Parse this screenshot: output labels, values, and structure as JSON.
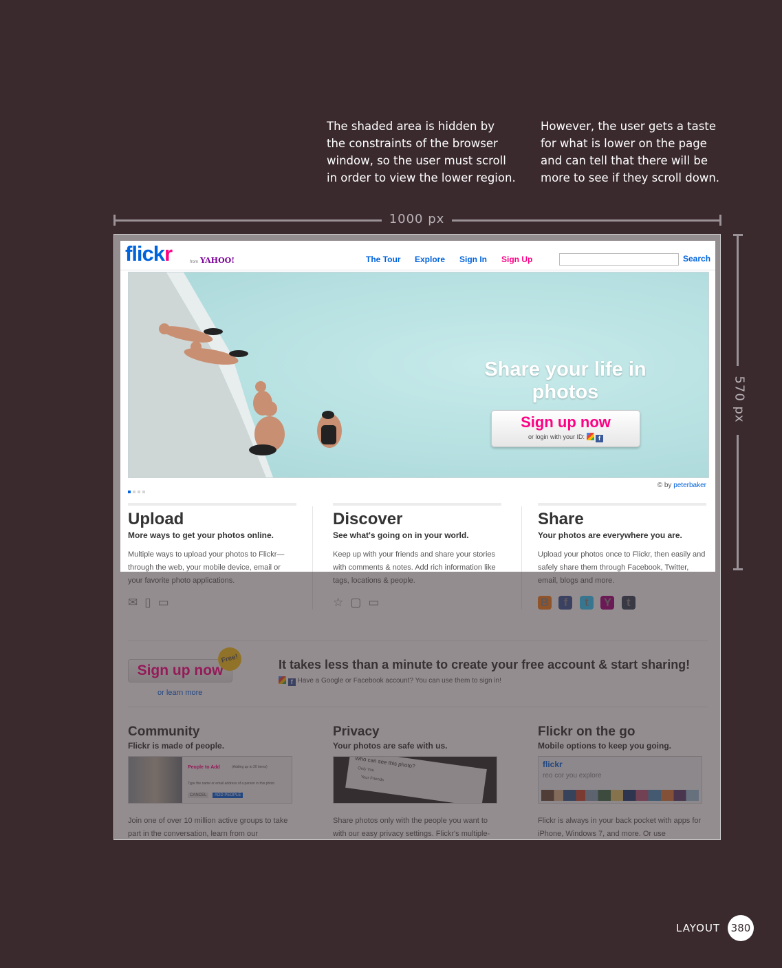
{
  "annotations": {
    "left": "The shaded area is hidden by\nthe constraints of the browser\nwindow, so the user must scroll\nin order to view the lower region.",
    "right": "However, the user gets a taste\nfor what is lower on the page\nand can tell that there will be\nmore to see if they scroll down."
  },
  "dimensions": {
    "width_label": "1000 px",
    "height_label": "570 px"
  },
  "site": {
    "logo_text_main": "flick",
    "logo_text_accent": "r",
    "logo_by": "from",
    "logo_yahoo": "YAHOO!",
    "nav": [
      "The Tour",
      "Explore",
      "Sign In",
      "Sign Up"
    ],
    "search_button": "Search",
    "hero": {
      "title": "Share your life in photos",
      "cta": "Sign up now",
      "cta_sub": "or login with your ID:",
      "credit_prefix": "© by",
      "credit_name": "peterbaker"
    },
    "columns": [
      {
        "title": "Upload",
        "tagline": "More ways to get your photos online.",
        "desc": "Multiple ways to upload your photos to Flickr—through the web, your mobile device, email or your favorite photo applications."
      },
      {
        "title": "Discover",
        "tagline": "See what's going on in your world.",
        "desc": "Keep up with your friends and share your stories with comments & notes. Add rich information like tags, locations & people."
      },
      {
        "title": "Share",
        "tagline": "Your photos are everywhere you are.",
        "desc": "Upload your photos once to Flickr, then easily and safely share them through Facebook, Twitter, email, blogs and more."
      }
    ],
    "signup_strip": {
      "button": "Sign up now",
      "badge": "Free!",
      "learn_more": "or learn more",
      "headline": "It takes less than a minute to create your free account & start sharing!",
      "sub": "Have a Google or Facebook account? You can use them to sign in!"
    },
    "bottom_columns": [
      {
        "title": "Community",
        "tagline": "Flickr is made of people.",
        "desc": "Join one of over 10 million active groups to take part in the conversation, learn from our",
        "thumb_text_1": "People to Add",
        "thumb_text_2": "(Adding up to 20 items)",
        "thumb_text_3": "Type the name or email address of a person in this photo",
        "thumb_btn_1": "CANCEL",
        "thumb_btn_2": "ADD PEOPLE"
      },
      {
        "title": "Privacy",
        "tagline": "Your photos are safe with us.",
        "desc": "Share photos only with the people you want to with our easy privacy settings. Flickr's multiple-",
        "thumb_text_1": "Who can see this photo?",
        "thumb_text_2": "Only You",
        "thumb_text_3": "Your Friends"
      },
      {
        "title": "Flickr on the go",
        "tagline": "Mobile options to keep you going.",
        "desc": "Flickr is always in your back pocket with apps for iPhone, Windows 7, and more. Or use",
        "thumb_text_1": "flickr",
        "thumb_text_2": "reo cor you explore"
      }
    ]
  },
  "footer": {
    "section": "LAYOUT",
    "page": "380"
  }
}
